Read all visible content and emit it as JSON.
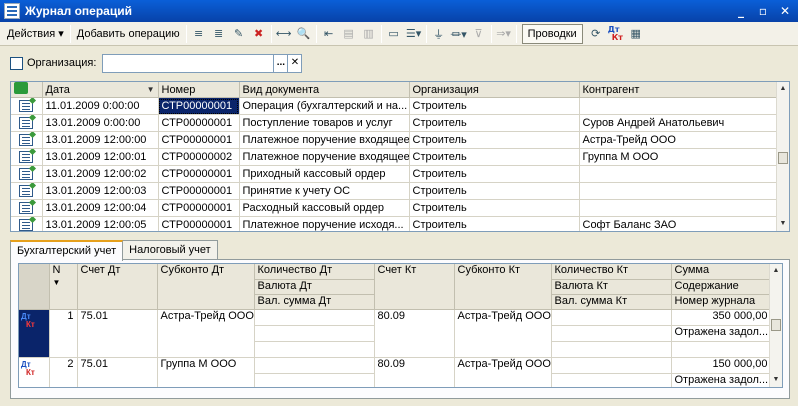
{
  "window": {
    "title": "Журнал операций",
    "minimize": "_",
    "restore": "▫",
    "close": "✕"
  },
  "toolbar": {
    "actions_label": "Действия ▾",
    "add_label": "Добавить операцию",
    "postings_label": "Проводки",
    "dt_label": "Дт",
    "kt_label": "Кт"
  },
  "filter": {
    "org_label": "Организация:",
    "org_value": "",
    "select_btn": "...",
    "clear_btn": "✕"
  },
  "journal": {
    "headers": [
      "",
      "Дата",
      "Номер",
      "Вид документа",
      "Организация",
      "Контрагент"
    ],
    "rows": [
      {
        "date": "11.01.2009 0:00:00",
        "number": "СТР00000001",
        "doctype": "Операция (бухгалтерский и на...",
        "org": "Строитель",
        "contractor": ""
      },
      {
        "date": "13.01.2009 0:00:00",
        "number": "СТР00000001",
        "doctype": "Поступление товаров и услуг",
        "org": "Строитель",
        "contractor": "Суров Андрей Анатольевич"
      },
      {
        "date": "13.01.2009 12:00:00",
        "number": "СТР00000001",
        "doctype": "Платежное поручение входящее",
        "org": "Строитель",
        "contractor": "Астра-Трейд ООО"
      },
      {
        "date": "13.01.2009 12:00:01",
        "number": "СТР00000002",
        "doctype": "Платежное поручение входящее",
        "org": "Строитель",
        "contractor": "Группа М ООО"
      },
      {
        "date": "13.01.2009 12:00:02",
        "number": "СТР00000001",
        "doctype": "Приходный кассовый ордер",
        "org": "Строитель",
        "contractor": ""
      },
      {
        "date": "13.01.2009 12:00:03",
        "number": "СТР00000001",
        "doctype": "Принятие к учету ОС",
        "org": "Строитель",
        "contractor": ""
      },
      {
        "date": "13.01.2009 12:00:04",
        "number": "СТР00000001",
        "doctype": "Расходный кассовый ордер",
        "org": "Строитель",
        "contractor": ""
      },
      {
        "date": "13.01.2009 12:00:05",
        "number": "СТР00000001",
        "doctype": "Платежное поручение исходя...",
        "org": "Строитель",
        "contractor": "Софт Баланс ЗАО"
      }
    ]
  },
  "tabs": {
    "accounting": "Бухгалтерский учет",
    "tax": "Налоговый учет"
  },
  "postings": {
    "h_n": "N",
    "h_debit": "Счет Дт",
    "h_subconto_dt": "Субконто Дт",
    "h_qty_dt": "Количество Дт",
    "h_cur_dt": "Валюта Дт",
    "h_cursum_dt": "Вал. сумма Дт",
    "h_credit": "Счет Кт",
    "h_subconto_kt": "Субконто Кт",
    "h_qty_kt": "Количество Кт",
    "h_cur_kt": "Валюта Кт",
    "h_cursum_kt": "Вал. сумма Кт",
    "h_sum": "Сумма",
    "h_content": "Содержание",
    "h_journal": "Номер журнала",
    "rows": [
      {
        "n": "1",
        "debit": "75.01",
        "subconto_dt": "Астра-Трейд ООО",
        "credit": "80.09",
        "subconto_kt": "Астра-Трейд ООО",
        "sum": "350 000,00",
        "content": "Отражена задол..."
      },
      {
        "n": "2",
        "debit": "75.01",
        "subconto_dt": "Группа М ООО",
        "credit": "80.09",
        "subconto_kt": "Астра-Трейд ООО",
        "sum": "150 000,00",
        "content": "Отражена задол..."
      }
    ]
  }
}
